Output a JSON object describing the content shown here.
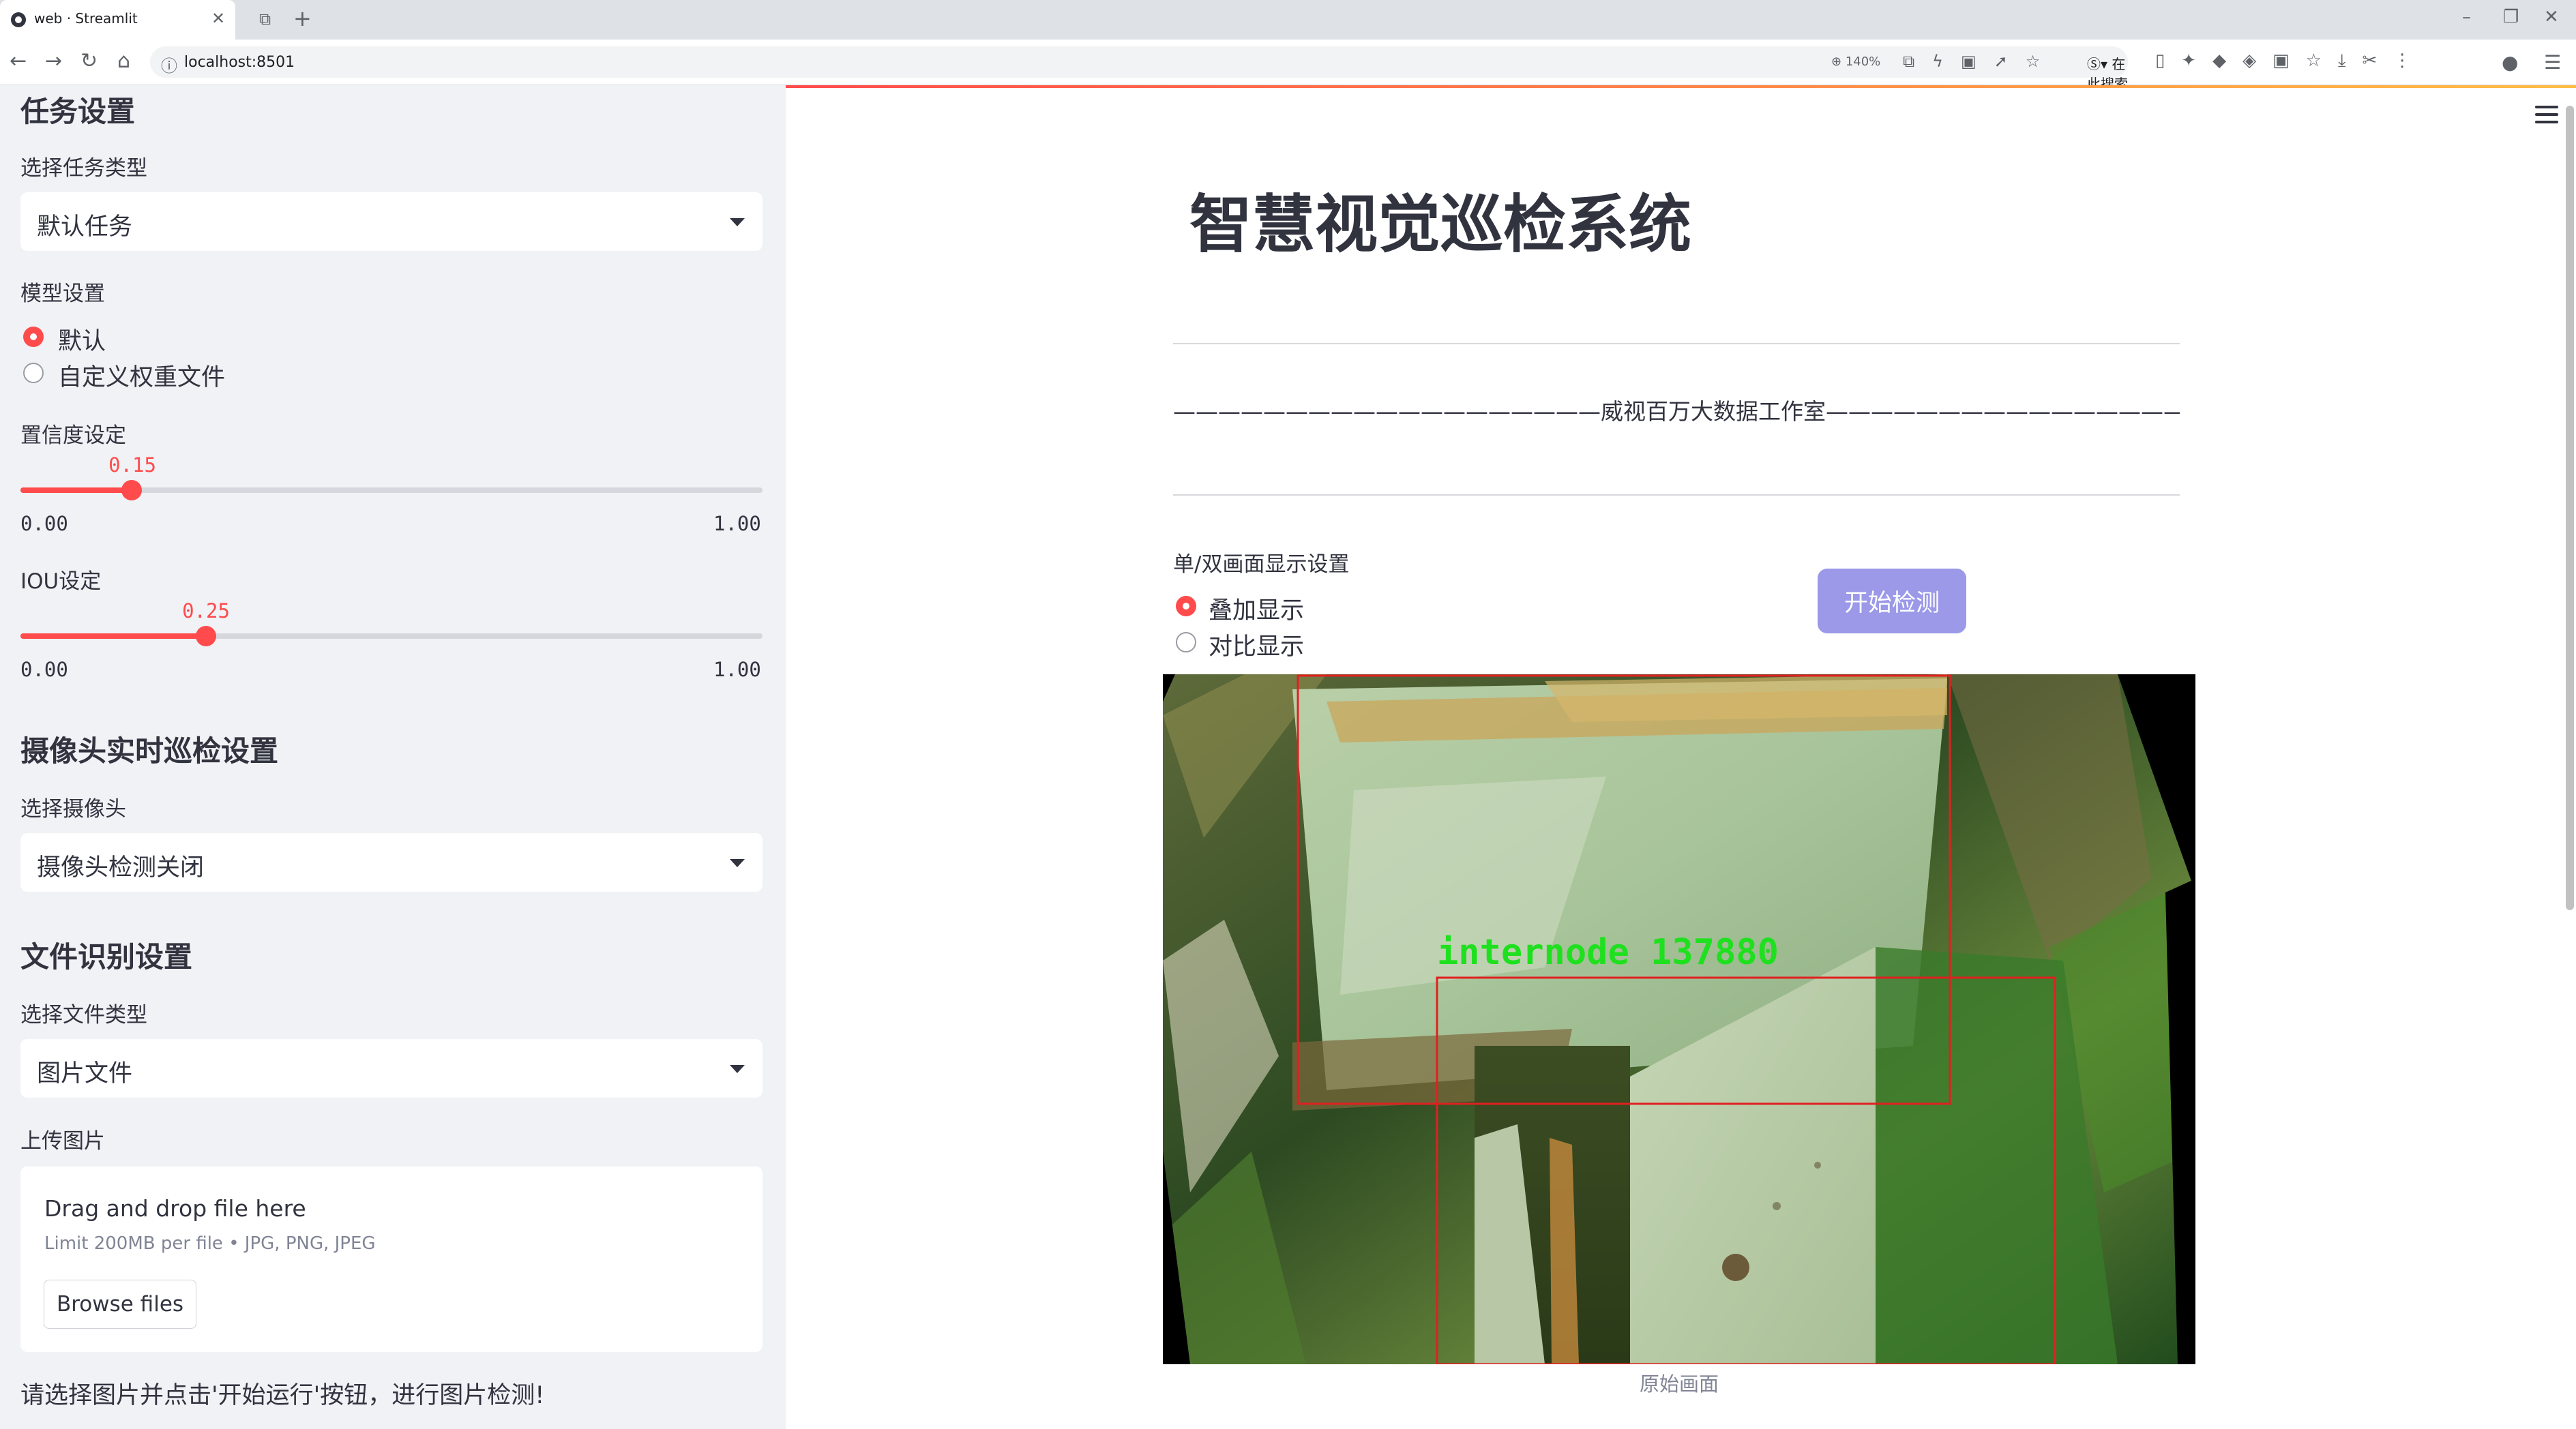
{
  "browser": {
    "tab_title": "web · Streamlit",
    "url": "localhost:8501",
    "zoom": "140%",
    "search_engine_label": "在此搜索"
  },
  "sidebar": {
    "task_section_title": "任务设置",
    "task_type_label": "选择任务类型",
    "task_type_value": "默认任务",
    "model_label": "模型设置",
    "model_options": [
      "默认",
      "自定义权重文件"
    ],
    "model_selected": "默认",
    "confidence": {
      "label": "置信度设定",
      "value": "0.15",
      "min": "0.00",
      "max": "1.00",
      "fraction": 0.15
    },
    "iou": {
      "label": "IOU设定",
      "value": "0.25",
      "min": "0.00",
      "max": "1.00",
      "fraction": 0.25
    },
    "camera_section_title": "摄像头实时巡检设置",
    "camera_label": "选择摄像头",
    "camera_value": "摄像头检测关闭",
    "file_section_title": "文件识别设置",
    "file_type_label": "选择文件类型",
    "file_type_value": "图片文件",
    "upload_label": "上传图片",
    "upload_title": "Drag and drop file here",
    "upload_limit": "Limit 200MB per file • JPG, PNG, JPEG",
    "browse_label": "Browse files",
    "hint": "请选择图片并点击'开始运行'按钮，进行图片检测!"
  },
  "main": {
    "title": "智慧视觉巡检系统",
    "studio_line": "———————————————————威视百万大数据工作室————————————————————",
    "display_label": "单/双画面显示设置",
    "display_options": [
      "叠加显示",
      "对比显示"
    ],
    "display_selected": "叠加显示",
    "start_button": "开始检测",
    "detection_label": "internode 137880",
    "image_caption": "原始画面"
  },
  "colors": {
    "accent": "#ff4b4b",
    "button": "#9b99e8",
    "detection_text": "#1fe01f",
    "box": "#e02020"
  }
}
